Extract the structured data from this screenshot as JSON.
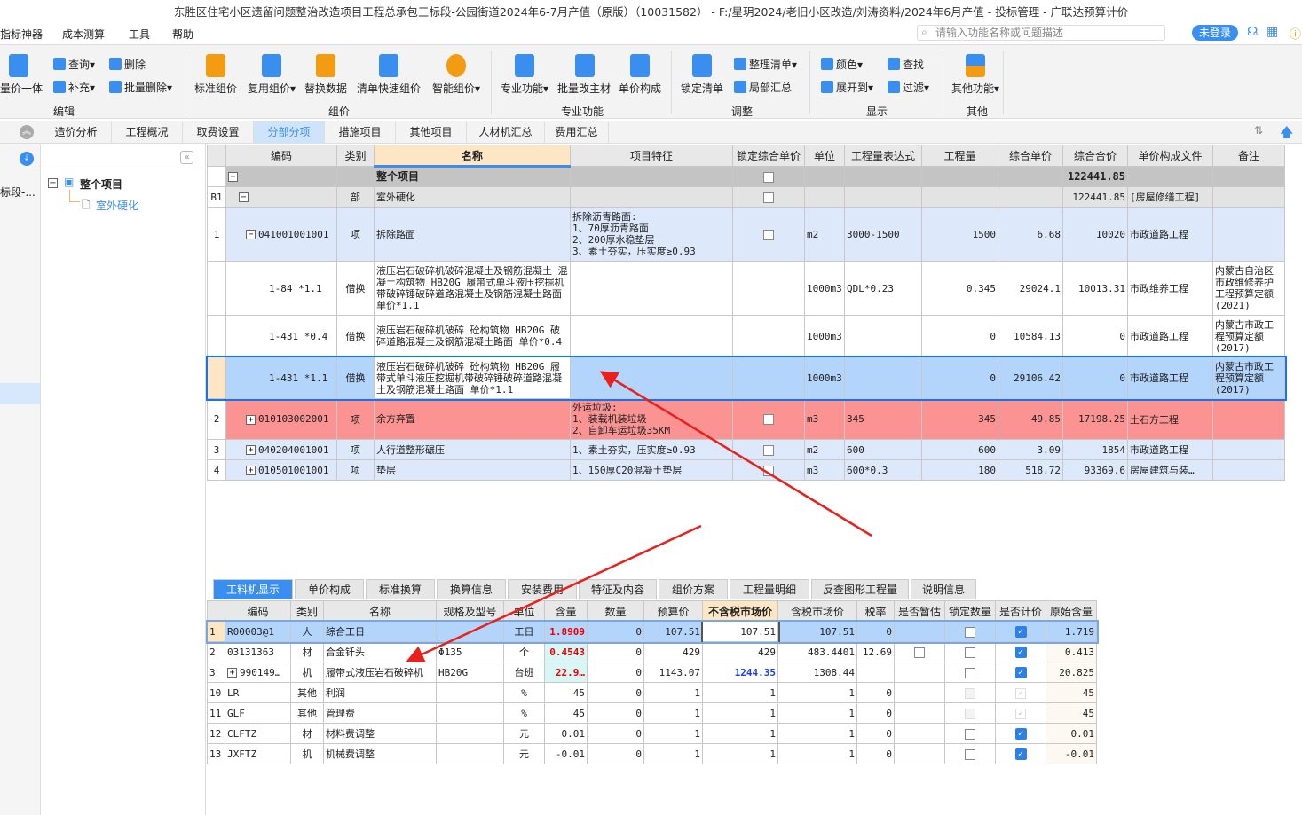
{
  "title": "东胜区住宅小区遗留问题整治改造项目工程总承包三标段-公园街道2024年6-7月产值（原版）（10031582） - F:/星玥2024/老旧小区改造/刘涛资料/2024年6月产值 - 投标管理 - 广联达预算计价",
  "menu": [
    "指标神器",
    "成本测算",
    "工具",
    "帮助"
  ],
  "search_placeholder": "请输入功能名称或问题描述",
  "login": "未登录",
  "ribbon": {
    "edit": {
      "label": "编辑",
      "items": [
        "量价一体",
        "查询",
        "补充",
        "删除",
        "批量删除"
      ]
    },
    "price": {
      "label": "组价",
      "items": [
        "标准组价",
        "复用组价",
        "替换数据",
        "清单快速组价",
        "智能组价"
      ]
    },
    "pro": {
      "label": "专业功能",
      "items": [
        "专业功能",
        "批量改主材",
        "单价构成"
      ]
    },
    "adjust": {
      "label": "调整",
      "items": [
        "锁定清单",
        "整理清单",
        "局部汇总"
      ]
    },
    "display": {
      "label": "显示",
      "items": [
        "颜色",
        "查找",
        "展开到",
        "过滤"
      ]
    },
    "other": {
      "label": "其他",
      "items": [
        "其他功能"
      ]
    }
  },
  "tabs": [
    "造价分析",
    "工程概况",
    "取费设置",
    "分部分项",
    "措施项目",
    "其他项目",
    "人材机汇总",
    "费用汇总"
  ],
  "active_tab": "分部分项",
  "left_strip_text": "标段-...",
  "tree": {
    "root": "整个项目",
    "child": "室外硬化"
  },
  "main": {
    "columns": [
      "",
      "编码",
      "类别",
      "名称",
      "项目特征",
      "锁定综合单价",
      "单位",
      "工程量表达式",
      "工程量",
      "综合单价",
      "综合合价",
      "单价构成文件",
      "备注"
    ],
    "rows": [
      {
        "type": "root",
        "no": "",
        "code": "",
        "cat": "",
        "name": "整个项目",
        "feat": "",
        "lock": "box",
        "unit": "",
        "expr": "",
        "qty": "",
        "price": "",
        "total": "122441.85",
        "file": "",
        "note": ""
      },
      {
        "type": "part",
        "no": "B1",
        "code": "",
        "cat": "部",
        "name": "室外硬化",
        "feat": "",
        "lock": "box",
        "unit": "",
        "expr": "",
        "qty": "",
        "price": "",
        "total": "122441.85",
        "file": "[房屋修缮工程]",
        "note": ""
      },
      {
        "type": "item",
        "no": "1",
        "code": "041001001001",
        "cat": "项",
        "name": "拆除路面",
        "feat": "拆除沥青路面:\n1、70厚沥青路面\n2、200厚水稳垫层\n3、素土夯实，压实度≥0.93",
        "lock": "box",
        "unit": "m2",
        "expr": "3000-1500",
        "qty": "1500",
        "price": "6.68",
        "total": "10020",
        "file": "市政道路工程",
        "note": ""
      },
      {
        "type": "sub",
        "no": "",
        "code": "1-84 *1.1",
        "cat": "借换",
        "name": "液压岩石破碎机破碎混凝土及钢筋混凝土 混凝土构筑物 HB20G 履带式单斗液压挖掘机带破碎锤破碎道路混凝土及钢筋混凝土路面 单价*1.1",
        "feat": "",
        "lock": "",
        "unit": "1000m3",
        "expr": "QDL*0.23",
        "qty": "0.345",
        "price": "29024.1",
        "total": "10013.31",
        "file": "市政维养工程",
        "note": "内蒙古自治区市政维修养护工程预算定额(2021)"
      },
      {
        "type": "sub",
        "no": "",
        "code": "1-431 *0.4",
        "cat": "借换",
        "name": "液压岩石破碎机破碎 砼构筑物 HB20G 破碎道路混凝土及钢筋混凝土路面 单价*0.4",
        "feat": "",
        "lock": "",
        "unit": "1000m3",
        "expr": "",
        "qty": "0",
        "price": "10584.13",
        "total": "0",
        "file": "市政道路工程",
        "note": "内蒙古市政工程预算定额(2017)"
      },
      {
        "type": "sel",
        "no": "",
        "code": "1-431 *1.1",
        "cat": "借换",
        "name": "液压岩石破碎机破碎 砼构筑物 HB20G 履带式单斗液压挖掘机带破碎锤破碎道路混凝土及钢筋混凝土路面 单价*1.1",
        "feat": "",
        "lock": "",
        "unit": "1000m3",
        "expr": "",
        "qty": "0",
        "price": "29106.42",
        "total": "0",
        "file": "市政道路工程",
        "note": "内蒙古市政工程预算定额(2017)"
      },
      {
        "type": "red",
        "no": "2",
        "code": "010103002001",
        "cat": "项",
        "name": "余方弃置",
        "feat": "外运垃圾:\n1、装载机装垃圾\n2、自卸车运垃圾35KM",
        "lock": "box",
        "unit": "m3",
        "expr": "345",
        "qty": "345",
        "price": "49.85",
        "total": "17198.25",
        "file": "土石方工程",
        "note": ""
      },
      {
        "type": "item",
        "no": "3",
        "code": "040204001001",
        "cat": "项",
        "name": "人行道整形碾压",
        "feat": "1、素土夯实，压实度≥0.93",
        "lock": "box",
        "unit": "m2",
        "expr": "600",
        "qty": "600",
        "price": "3.09",
        "total": "1854",
        "file": "市政道路工程",
        "note": ""
      },
      {
        "type": "item",
        "no": "4",
        "code": "010501001001",
        "cat": "项",
        "name": "垫层",
        "feat": "1、150厚C20混凝土垫层",
        "lock": "box",
        "unit": "m3",
        "expr": "600*0.3",
        "qty": "180",
        "price": "518.72",
        "total": "93369.6",
        "file": "房屋建筑与装…",
        "note": ""
      }
    ]
  },
  "bottom": {
    "tabs": [
      "工料机显示",
      "单价构成",
      "标准换算",
      "换算信息",
      "安装费用",
      "特征及内容",
      "组价方案",
      "工程量明细",
      "反查图形工程量",
      "说明信息"
    ],
    "columns": [
      "",
      "编码",
      "类别",
      "名称",
      "规格及型号",
      "单位",
      "含量",
      "数量",
      "预算价",
      "不含税市场价",
      "含税市场价",
      "税率",
      "是否暂估",
      "锁定数量",
      "是否计价",
      "原始含量"
    ],
    "rows": [
      {
        "no": "1",
        "code": "R00003@1",
        "cat": "人",
        "name": "综合工日",
        "spec": "",
        "unit": "工日",
        "amt": "1.8909",
        "num": "0",
        "bp": "107.51",
        "mp": "107.51",
        "tp": "107.51",
        "rate": "0",
        "est": "",
        "lockq": "box",
        "priced": "check",
        "orig": "1.719"
      },
      {
        "no": "2",
        "code": "03131363",
        "cat": "材",
        "name": "合金钎头",
        "spec": "Φ135",
        "unit": "个",
        "amt": "0.4543",
        "num": "0",
        "bp": "429",
        "mp": "429",
        "tp": "483.4401",
        "rate": "12.69",
        "est": "box",
        "lockq": "box",
        "priced": "check",
        "orig": "0.413"
      },
      {
        "no": "3",
        "code": "990149…",
        "cat": "机",
        "name": "履带式液压岩石破碎机",
        "spec": "HB20G",
        "unit": "台班",
        "amt": "22.9…",
        "num": "0",
        "bp": "1143.07",
        "mp": "1244.35",
        "tp": "1308.44",
        "rate": "",
        "est": "",
        "lockq": "box",
        "priced": "check",
        "orig": "20.825"
      },
      {
        "no": "10",
        "code": "LR",
        "cat": "其他",
        "name": "利润",
        "spec": "",
        "unit": "%",
        "amt": "45",
        "num": "0",
        "bp": "1",
        "mp": "1",
        "tp": "1",
        "rate": "0",
        "est": "",
        "lockq": "dis",
        "priced": "dischk",
        "orig": "45"
      },
      {
        "no": "11",
        "code": "GLF",
        "cat": "其他",
        "name": "管理费",
        "spec": "",
        "unit": "%",
        "amt": "45",
        "num": "0",
        "bp": "1",
        "mp": "1",
        "tp": "1",
        "rate": "0",
        "est": "",
        "lockq": "dis",
        "priced": "dischk",
        "orig": "45"
      },
      {
        "no": "12",
        "code": "CLFTZ",
        "cat": "材",
        "name": "材料费调整",
        "spec": "",
        "unit": "元",
        "amt": "0.01",
        "num": "0",
        "bp": "1",
        "mp": "1",
        "tp": "1",
        "rate": "0",
        "est": "",
        "lockq": "box",
        "priced": "check",
        "orig": "0.01"
      },
      {
        "no": "13",
        "code": "JXFTZ",
        "cat": "机",
        "name": "机械费调整",
        "spec": "",
        "unit": "元",
        "amt": "-0.01",
        "num": "0",
        "bp": "1",
        "mp": "1",
        "tp": "1",
        "rate": "0",
        "est": "",
        "lockq": "box",
        "priced": "check",
        "orig": "-0.01"
      }
    ]
  },
  "colors": {
    "accent": "#3a8ef0",
    "selected": "#b3d4fb",
    "item_row": "#dde9fb",
    "red_row": "#fb9393",
    "annotation_arrow": "#e8211d"
  }
}
